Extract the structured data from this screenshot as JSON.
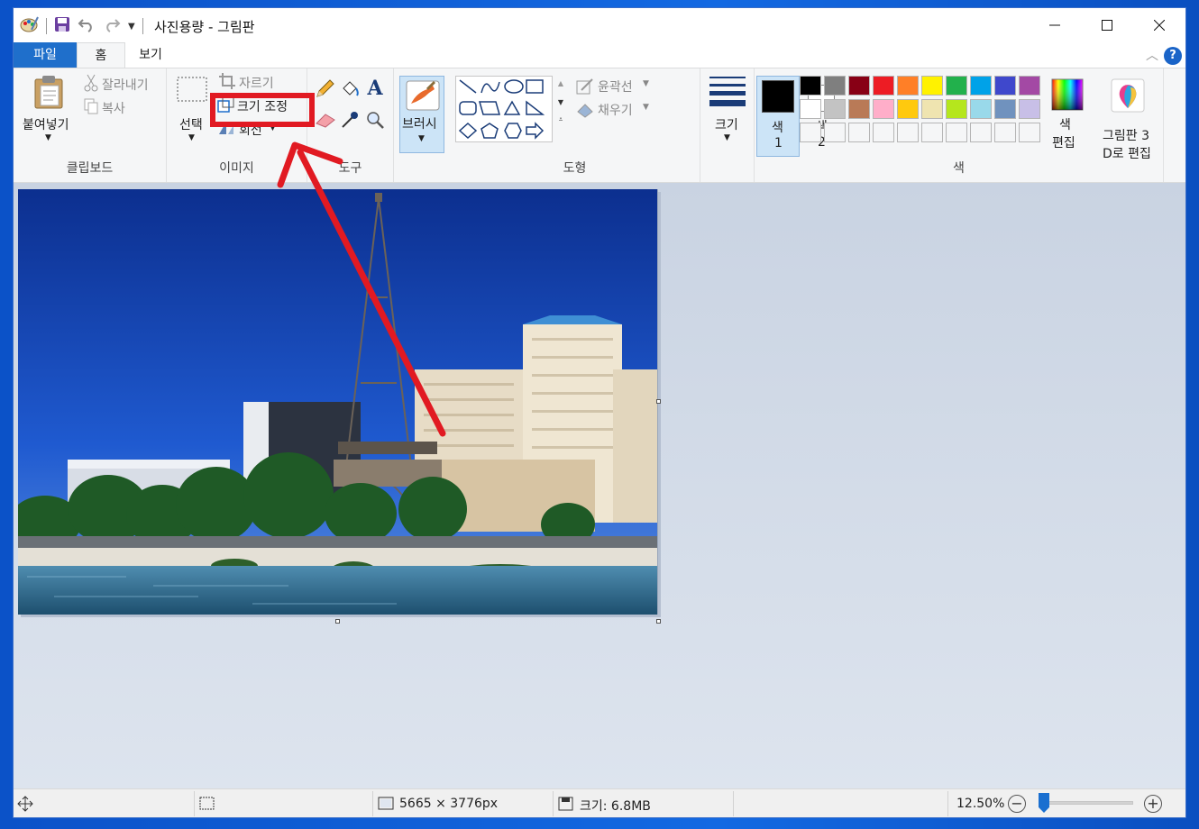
{
  "window": {
    "title": "사진용량 - 그림판"
  },
  "tabs": [
    {
      "label": "파일"
    },
    {
      "label": "홈"
    },
    {
      "label": "보기"
    }
  ],
  "clipboard": {
    "paste": "붙여넣기",
    "cut": "잘라내기",
    "copy": "복사",
    "label": "클립보드"
  },
  "image": {
    "select": "선택",
    "crop": "자르기",
    "resize": "크기 조정",
    "rotate": "회전",
    "label": "이미지"
  },
  "tools": {
    "label": "도구"
  },
  "brush": {
    "label": "브러시"
  },
  "shapes": {
    "outline": "윤곽선",
    "fill": "채우기",
    "label": "도형"
  },
  "size": {
    "label": "크기"
  },
  "colors": {
    "color1_label": "색",
    "color1_num": "1",
    "color2_label": "색",
    "color2_num": "2",
    "edit_colors_line1": "색",
    "edit_colors_line2": "편집",
    "label": "색",
    "color1_value": "#000000",
    "color2_value": "#ffffff",
    "palette_row1": [
      "#000000",
      "#7f7f7f",
      "#880015",
      "#ed1c24",
      "#ff7f27",
      "#fff200",
      "#22b14c",
      "#00a2e8",
      "#3f48cc",
      "#a349a4"
    ],
    "palette_row2": [
      "#ffffff",
      "#c3c3c3",
      "#b97a57",
      "#ffaec9",
      "#ffc90e",
      "#efe4b0",
      "#b5e61d",
      "#99d9ea",
      "#7092be",
      "#c8bfe7"
    ]
  },
  "paint3d": {
    "line1": "그림판 3",
    "line2": "D로 편집"
  },
  "status": {
    "dimensions": "5665 × 3776px",
    "file_size": "크기: 6.8MB",
    "zoom": "12.50%"
  },
  "accent": {
    "file_tab": "#1f6fcb",
    "annotation": "#e11a22",
    "brush_active": "#cce4f7"
  }
}
